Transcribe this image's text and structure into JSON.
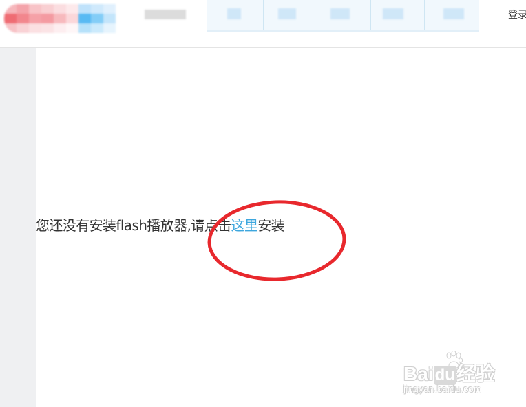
{
  "header": {
    "login_label": "登录"
  },
  "message": {
    "prefix": "您还没有安装flash播放器,请点击",
    "link_label": "这里",
    "suffix": "安装"
  },
  "watermark": {
    "brand_prefix": "Bai",
    "brand_highlight": "du",
    "brand_suffix": "经验",
    "domain": "jingyan.baidu.com"
  },
  "colors": {
    "link": "#3ea7de",
    "annotation": "#e8282d",
    "text": "#333333"
  }
}
